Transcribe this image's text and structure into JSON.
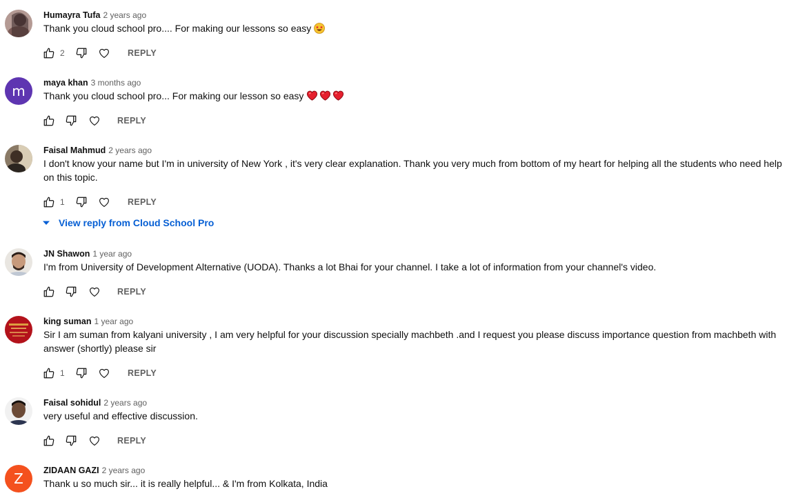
{
  "comments": [
    {
      "author": "Humayra Tufa",
      "time": "2 years ago",
      "text": "Thank you cloud school pro.... For making our lessons so easy",
      "likes": "2",
      "reply_label": "REPLY"
    },
    {
      "author": "maya khan",
      "time": "3 months ago",
      "text": "Thank you cloud school pro... For making our lesson so easy",
      "likes": "",
      "reply_label": "REPLY",
      "avatar_letter": "m",
      "avatar_color": "#5e35b1"
    },
    {
      "author": "Faisal Mahmud",
      "time": "2 years ago",
      "text": "I don't know your name but I'm in university of New York , it's very clear explanation. Thank you very much from bottom of my heart for helping all the students who need help on this topic.",
      "likes": "1",
      "reply_label": "REPLY"
    },
    {
      "author": "JN Shawon",
      "time": "1 year ago",
      "text": "I'm from University of Development Alternative (UODA). Thanks a lot Bhai for your channel. I take a lot of information from your channel's video.",
      "likes": "",
      "reply_label": "REPLY"
    },
    {
      "author": "king suman",
      "time": "1 year ago",
      "text": "Sir I am suman from kalyani university , I am very helpful for your discussion specially machbeth .and I request you please discuss importance question from machbeth with answer (shortly) please sir",
      "likes": "1",
      "reply_label": "REPLY"
    },
    {
      "author": "Faisal sohidul",
      "time": "2 years ago",
      "text": "very useful and effective discussion.",
      "likes": "",
      "reply_label": "REPLY"
    },
    {
      "author": "ZIDAAN GAZI",
      "time": "2 years ago",
      "text": "Thank u so much sir... it is really helpful... & I'm from Kolkata, India",
      "likes": "",
      "reply_label": "REPLY",
      "avatar_letter": "Z",
      "avatar_color": "#f4511e"
    }
  ],
  "view_replies_label": "View reply from Cloud School Pro",
  "colors": {
    "link_blue": "#065fd4",
    "secondary_text": "#606060",
    "heart_red": "#e5202e"
  },
  "icons": [
    "like-icon",
    "dislike-icon",
    "heart-icon",
    "caret-down-icon",
    "star-struck-emoji",
    "red-heart-emoji"
  ]
}
